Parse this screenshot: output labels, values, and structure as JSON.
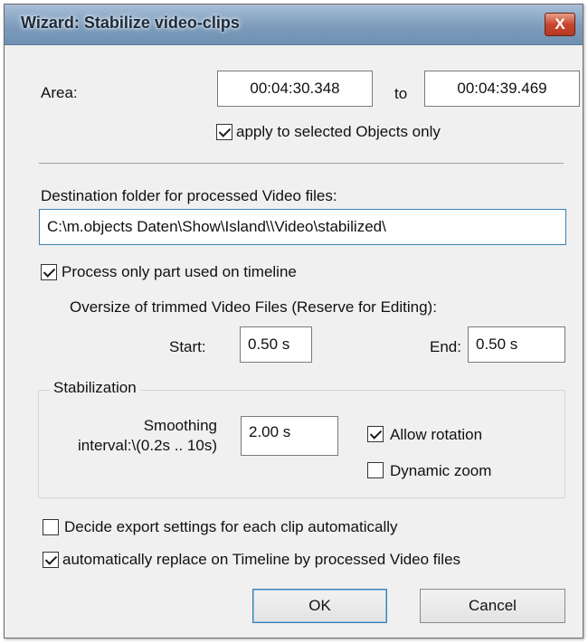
{
  "window": {
    "title": "Wizard: Stabilize video-clips",
    "close_glyph": "X"
  },
  "area": {
    "label": "Area:",
    "from_value": "00:04:30.348",
    "to_label": "to",
    "to_value": "00:04:39.469",
    "selected_only_label": "apply to selected Objects only",
    "selected_only_checked": true
  },
  "destination": {
    "label": "Destination folder for processed Video files:",
    "path": "C:\\m.objects Daten\\Show\\Island\\\\Video\\stabilized\\"
  },
  "process_part": {
    "label": "Process only part used on timeline",
    "checked": true
  },
  "oversize": {
    "label": "Oversize of trimmed Video Files (Reserve for Editing):",
    "start_label": "Start:",
    "start_value": "0.50 s",
    "end_label": "End:",
    "end_value": "0.50 s"
  },
  "stabilization": {
    "group_label": "Stabilization",
    "smoothing_label_line1": "Smoothing",
    "smoothing_label_line2": "interval:\\(0.2s .. 10s)",
    "smoothing_value": "2.00 s",
    "allow_rotation_label": "Allow rotation",
    "allow_rotation_checked": true,
    "dynamic_zoom_label": "Dynamic zoom",
    "dynamic_zoom_checked": false
  },
  "options": {
    "decide_export_label": "Decide export settings for each clip automatically",
    "decide_export_checked": false,
    "auto_replace_label": "automatically replace on Timeline by processed Video files",
    "auto_replace_checked": true
  },
  "buttons": {
    "ok_label": "OK",
    "cancel_label": "Cancel"
  }
}
